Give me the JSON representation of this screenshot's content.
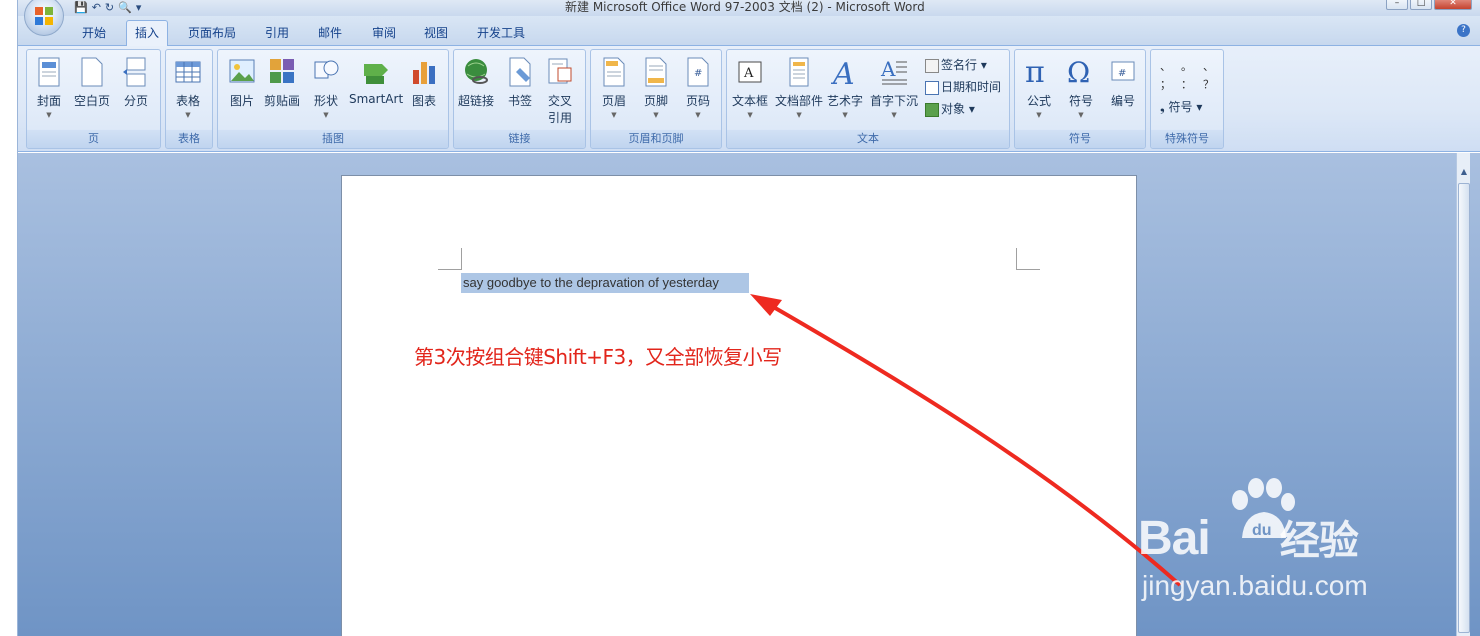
{
  "window": {
    "title": "新建 Microsoft Office Word 97-2003 文档 (2) - Microsoft Word"
  },
  "qat": {
    "save_icon": "💾",
    "undo_icon": "↶",
    "redo_icon": "↻",
    "preview_icon": "🔍",
    "more_icon": "▾"
  },
  "tabs": [
    "开始",
    "插入",
    "页面布局",
    "引用",
    "邮件",
    "审阅",
    "视图",
    "开发工具"
  ],
  "active_tab": "插入",
  "ribbon": {
    "groups": [
      {
        "label": "页",
        "commands": [
          "封面",
          "空白页",
          "分页"
        ]
      },
      {
        "label": "表格",
        "commands": [
          "表格"
        ]
      },
      {
        "label": "插图",
        "commands": [
          "图片",
          "剪贴画",
          "形状",
          "SmartArt",
          "图表"
        ]
      },
      {
        "label": "链接",
        "commands": [
          "超链接",
          "书签",
          "交叉",
          "引用"
        ]
      },
      {
        "label": "页眉和页脚",
        "commands": [
          "页眉",
          "页脚",
          "页码"
        ]
      },
      {
        "label": "文本",
        "commands": [
          "文本框",
          "文档部件",
          "艺术字",
          "首字下沉"
        ],
        "small_commands": [
          "签名行",
          "日期和时间",
          "对象"
        ]
      },
      {
        "label": "符号",
        "commands": [
          "公式",
          "符号",
          "编号"
        ]
      },
      {
        "label": "特殊符号",
        "small_commands": [
          "符号"
        ],
        "symbols": [
          "、",
          "。",
          "、",
          "；",
          "：",
          "？",
          "❟"
        ]
      }
    ]
  },
  "document": {
    "selected_text": "say goodbye to the depravation of yesterday",
    "annotation": "第3次按组合键Shift+F3，又全部恢复小写"
  },
  "watermark": {
    "brand": "Bai",
    "brand_suffix": "经验",
    "paw_text": "du",
    "url": "jingyan.baidu.com"
  },
  "colors": {
    "annotation": "#e2251b",
    "selection": "#adc6e5",
    "workspace": "#6f94c5"
  }
}
